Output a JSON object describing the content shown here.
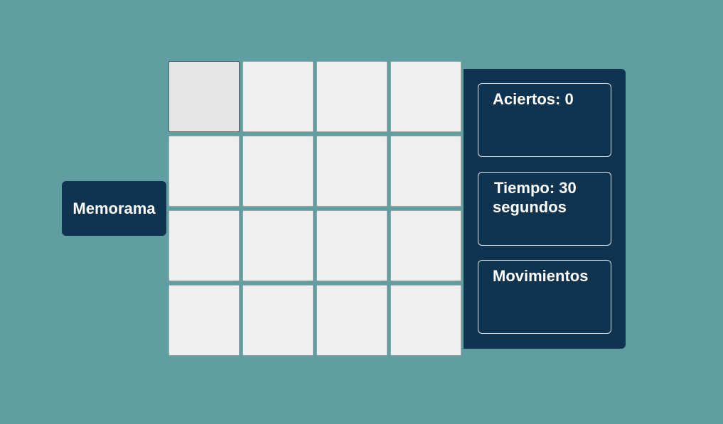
{
  "app": {
    "title": "Memorama"
  },
  "board": {
    "rows": 4,
    "cols": 4,
    "hovered_index": 0
  },
  "stats": {
    "aciertos": "Aciertos: 0",
    "tiempo_line1": "Tiempo: 30",
    "tiempo_line2": "segundos",
    "movimientos": "Movimientos"
  },
  "colors": {
    "background": "#609ea2",
    "panel": "#10344f",
    "card": "#efefef",
    "card_hover": "#e5e5e5",
    "text": "#ffffff"
  }
}
